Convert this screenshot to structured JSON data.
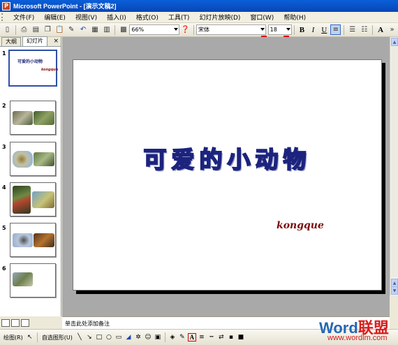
{
  "window": {
    "title": "Microsoft PowerPoint - [演示文稿2]"
  },
  "menu": [
    "文件(F)",
    "编辑(E)",
    "视图(V)",
    "插入(I)",
    "格式(O)",
    "工具(T)",
    "幻灯片放映(D)",
    "窗口(W)",
    "帮助(H)"
  ],
  "toolbar": {
    "zoom": "66%",
    "font_name": "宋体",
    "font_size": "18",
    "bold": "B",
    "italic": "I",
    "underline": "U",
    "grow_font": "A"
  },
  "left_pane": {
    "tab_outline": "大纲",
    "tab_slides": "幻灯片",
    "close": "×",
    "slide_numbers": [
      "1",
      "2",
      "3",
      "4",
      "5",
      "6"
    ],
    "selected_slide": 1
  },
  "slide": {
    "title": "可爱的小动物",
    "subtitle": "kongque"
  },
  "notes": {
    "placeholder": "单击此处添加备注"
  },
  "drawbar": {
    "draw_label": "绘图(R)",
    "autoshapes_label": "自选图形(U)"
  },
  "watermark": {
    "brand_latin": "Word",
    "brand_cn": "联盟",
    "url": "www.wordlm.com"
  },
  "colors": {
    "title_bar": "#0a5fd8",
    "slide_title_outline": "#1c237e",
    "subtitle": "#7b0e0e",
    "workspace": "#a9a9a9",
    "highlight_red": "#e00000"
  }
}
